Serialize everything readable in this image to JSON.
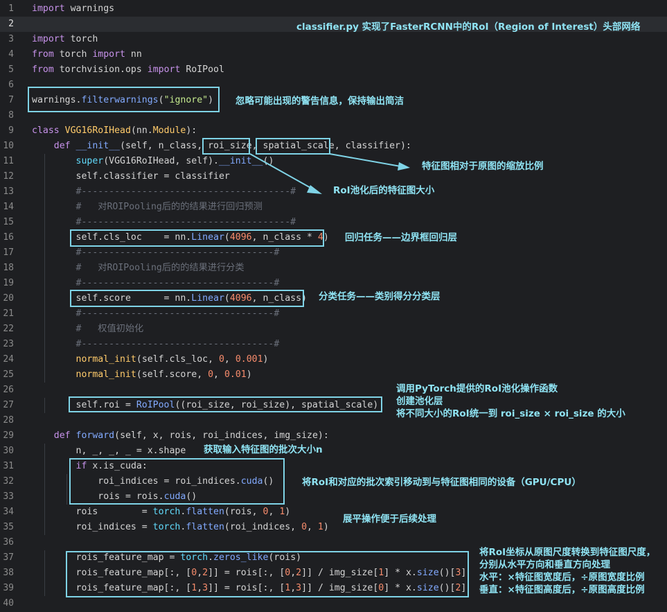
{
  "editor": {
    "current_line": 2,
    "lines": [
      {
        "n": "1",
        "t": [
          [
            "kw",
            "import"
          ],
          [
            "op",
            " warnings"
          ]
        ]
      },
      {
        "n": "2",
        "t": []
      },
      {
        "n": "3",
        "t": [
          [
            "kw",
            "import"
          ],
          [
            "op",
            " torch"
          ]
        ]
      },
      {
        "n": "4",
        "t": [
          [
            "kw",
            "from"
          ],
          [
            "op",
            " torch "
          ],
          [
            "kw",
            "import"
          ],
          [
            "op",
            " nn"
          ]
        ]
      },
      {
        "n": "5",
        "t": [
          [
            "kw",
            "from"
          ],
          [
            "op",
            " torchvision.ops "
          ],
          [
            "kw",
            "import"
          ],
          [
            "op",
            " RoIPool"
          ]
        ]
      },
      {
        "n": "6",
        "t": []
      },
      {
        "n": "7",
        "t": [
          [
            "op",
            "warnings."
          ],
          [
            "fn",
            "filterwarnings"
          ],
          [
            "op",
            "("
          ],
          [
            "st",
            "\"ignore\""
          ],
          [
            "op",
            ")"
          ]
        ]
      },
      {
        "n": "8",
        "t": []
      },
      {
        "n": "9",
        "t": [
          [
            "kw",
            "class"
          ],
          [
            "op",
            " "
          ],
          [
            "ca",
            "VGG16RoIHead"
          ],
          [
            "op",
            "(nn."
          ],
          [
            "ca",
            "Module"
          ],
          [
            "op",
            "):"
          ]
        ]
      },
      {
        "n": "10",
        "t": [
          [
            "op",
            "    "
          ],
          [
            "kw",
            "def"
          ],
          [
            "op",
            " "
          ],
          [
            "fn",
            "__init__"
          ],
          [
            "op",
            "(self, n_class, roi_size, spatial_scale, classifier):"
          ]
        ]
      },
      {
        "n": "11",
        "t": [
          [
            "op",
            "        "
          ],
          [
            "bi",
            "super"
          ],
          [
            "op",
            "(VGG16RoIHead, self)."
          ],
          [
            "fn",
            "__init__"
          ],
          [
            "op",
            "()"
          ]
        ]
      },
      {
        "n": "12",
        "t": [
          [
            "op",
            "        self.classifier = classifier"
          ]
        ]
      },
      {
        "n": "13",
        "t": [
          [
            "op",
            "        "
          ],
          [
            "cm",
            "#--------------------------------------#"
          ]
        ]
      },
      {
        "n": "14",
        "t": [
          [
            "op",
            "        "
          ],
          [
            "cm",
            "#   对ROIPooling后的的结果进行回归预测"
          ]
        ]
      },
      {
        "n": "15",
        "t": [
          [
            "op",
            "        "
          ],
          [
            "cm",
            "#--------------------------------------#"
          ]
        ]
      },
      {
        "n": "16",
        "t": [
          [
            "op",
            "        self.cls_loc    = nn."
          ],
          [
            "fn",
            "Linear"
          ],
          [
            "op",
            "("
          ],
          [
            "nm",
            "4096"
          ],
          [
            "op",
            ", n_class * "
          ],
          [
            "nm",
            "4"
          ],
          [
            "op",
            ")"
          ]
        ]
      },
      {
        "n": "17",
        "t": [
          [
            "op",
            "        "
          ],
          [
            "cm",
            "#-----------------------------------#"
          ]
        ]
      },
      {
        "n": "18",
        "t": [
          [
            "op",
            "        "
          ],
          [
            "cm",
            "#   对ROIPooling后的的结果进行分类"
          ]
        ]
      },
      {
        "n": "19",
        "t": [
          [
            "op",
            "        "
          ],
          [
            "cm",
            "#-----------------------------------#"
          ]
        ]
      },
      {
        "n": "20",
        "t": [
          [
            "op",
            "        self.score      = nn."
          ],
          [
            "fn",
            "Linear"
          ],
          [
            "op",
            "("
          ],
          [
            "nm",
            "4096"
          ],
          [
            "op",
            ", n_class)"
          ]
        ]
      },
      {
        "n": "21",
        "t": [
          [
            "op",
            "        "
          ],
          [
            "cm",
            "#-----------------------------------#"
          ]
        ]
      },
      {
        "n": "22",
        "t": [
          [
            "op",
            "        "
          ],
          [
            "cm",
            "#   权值初始化"
          ]
        ]
      },
      {
        "n": "23",
        "t": [
          [
            "op",
            "        "
          ],
          [
            "cm",
            "#-----------------------------------#"
          ]
        ]
      },
      {
        "n": "24",
        "t": [
          [
            "op",
            "        "
          ],
          [
            "ca",
            "normal_init"
          ],
          [
            "op",
            "(self.cls_loc, "
          ],
          [
            "nm",
            "0"
          ],
          [
            "op",
            ", "
          ],
          [
            "nm",
            "0.001"
          ],
          [
            "op",
            ")"
          ]
        ]
      },
      {
        "n": "25",
        "t": [
          [
            "op",
            "        "
          ],
          [
            "ca",
            "normal_init"
          ],
          [
            "op",
            "(self.score, "
          ],
          [
            "nm",
            "0"
          ],
          [
            "op",
            ", "
          ],
          [
            "nm",
            "0.01"
          ],
          [
            "op",
            ")"
          ]
        ]
      },
      {
        "n": "26",
        "t": []
      },
      {
        "n": "27",
        "t": [
          [
            "op",
            "        self.roi = "
          ],
          [
            "fn",
            "RoIPool"
          ],
          [
            "op",
            "((roi_size, roi_size), spatial_scale)"
          ]
        ]
      },
      {
        "n": "28",
        "t": []
      },
      {
        "n": "29",
        "t": [
          [
            "op",
            "    "
          ],
          [
            "kw",
            "def"
          ],
          [
            "op",
            " "
          ],
          [
            "fn",
            "forward"
          ],
          [
            "op",
            "(self, x, rois, roi_indices, img_size):"
          ]
        ]
      },
      {
        "n": "30",
        "t": [
          [
            "op",
            "        n, _, _, _ = x.shape"
          ]
        ]
      },
      {
        "n": "31",
        "t": [
          [
            "op",
            "        "
          ],
          [
            "kw",
            "if"
          ],
          [
            "op",
            " x.is_cuda:"
          ]
        ]
      },
      {
        "n": "32",
        "t": [
          [
            "op",
            "            roi_indices = roi_indices."
          ],
          [
            "fn",
            "cuda"
          ],
          [
            "op",
            "()"
          ]
        ]
      },
      {
        "n": "33",
        "t": [
          [
            "op",
            "            rois = rois."
          ],
          [
            "fn",
            "cuda"
          ],
          [
            "op",
            "()"
          ]
        ]
      },
      {
        "n": "34",
        "t": [
          [
            "op",
            "        rois        = "
          ],
          [
            "bi",
            "torch"
          ],
          [
            "op",
            "."
          ],
          [
            "fn",
            "flatten"
          ],
          [
            "op",
            "(rois, "
          ],
          [
            "nm",
            "0"
          ],
          [
            "op",
            ", "
          ],
          [
            "nm",
            "1"
          ],
          [
            "op",
            ")"
          ]
        ]
      },
      {
        "n": "35",
        "t": [
          [
            "op",
            "        roi_indices = "
          ],
          [
            "bi",
            "torch"
          ],
          [
            "op",
            "."
          ],
          [
            "fn",
            "flatten"
          ],
          [
            "op",
            "(roi_indices, "
          ],
          [
            "nm",
            "0"
          ],
          [
            "op",
            ", "
          ],
          [
            "nm",
            "1"
          ],
          [
            "op",
            ")"
          ]
        ]
      },
      {
        "n": "36",
        "t": []
      },
      {
        "n": "37",
        "t": [
          [
            "op",
            "        rois_feature_map = "
          ],
          [
            "bi",
            "torch"
          ],
          [
            "op",
            "."
          ],
          [
            "fn",
            "zeros_like"
          ],
          [
            "op",
            "(rois)"
          ]
        ]
      },
      {
        "n": "38",
        "t": [
          [
            "op",
            "        rois_feature_map[:, ["
          ],
          [
            "nm",
            "0"
          ],
          [
            "op",
            ","
          ],
          [
            "nm",
            "2"
          ],
          [
            "op",
            "]] = rois[:, ["
          ],
          [
            "nm",
            "0"
          ],
          [
            "op",
            ","
          ],
          [
            "nm",
            "2"
          ],
          [
            "op",
            "]] / img_size["
          ],
          [
            "nm",
            "1"
          ],
          [
            "op",
            "] * x."
          ],
          [
            "fn",
            "size"
          ],
          [
            "op",
            "()["
          ],
          [
            "nm",
            "3"
          ],
          [
            "op",
            "]"
          ]
        ]
      },
      {
        "n": "39",
        "t": [
          [
            "op",
            "        rois_feature_map[:, ["
          ],
          [
            "nm",
            "1"
          ],
          [
            "op",
            ","
          ],
          [
            "nm",
            "3"
          ],
          [
            "op",
            "]] = rois[:, ["
          ],
          [
            "nm",
            "1"
          ],
          [
            "op",
            ","
          ],
          [
            "nm",
            "3"
          ],
          [
            "op",
            "]] / img_size["
          ],
          [
            "nm",
            "0"
          ],
          [
            "op",
            "] * x."
          ],
          [
            "fn",
            "size"
          ],
          [
            "op",
            "()["
          ],
          [
            "nm",
            "2"
          ],
          [
            "op",
            "]"
          ]
        ]
      },
      {
        "n": "40",
        "t": []
      }
    ]
  },
  "annotations": {
    "title": "classifier.py 实现了FasterRCNN中的RoI（Region of Interest）头部网络",
    "warnings": "忽略可能出现的警告信息，保持输出简洁",
    "spatial_scale": "特征图相对于原图的缩放比例",
    "roi_size": "RoI池化后的特征图大小",
    "cls_loc": "回归任务——边界框回归层",
    "score": "分类任务——类别得分分类层",
    "roi_pool": [
      "调用PyTorch提供的RoI池化操作函数",
      "创建池化层",
      "将不同大小的RoI统一到 roi_size × roi_size 的大小"
    ],
    "shape": "获取输入特征图的批次大小n",
    "cuda": "将RoI和对应的批次索引移动到与特征图相同的设备（GPU/CPU）",
    "flatten": "展平操作便于后续处理",
    "feature_map": [
      "将RoI坐标从原图尺度转换到特征图尺度，",
      "分别从水平方向和垂直方向处理",
      "水平：×特征图宽度后，÷原图宽度比例",
      "垂直：×特征图高度后，÷原图高度比例"
    ]
  },
  "colors": {
    "background": "#1e1f22",
    "current_line": "#2b2d31",
    "annotation": "#8fe3f3",
    "box": "#7fd3e6"
  }
}
